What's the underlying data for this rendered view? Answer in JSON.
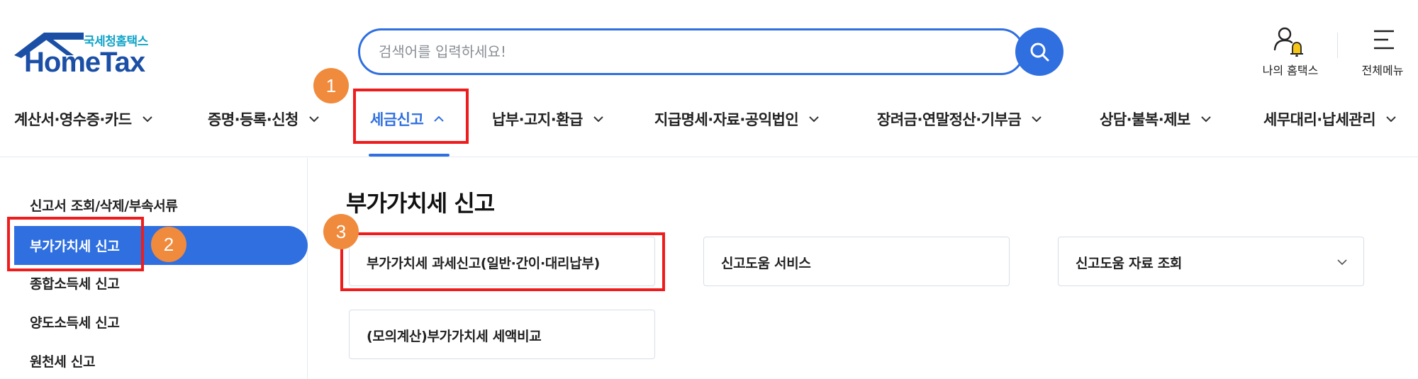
{
  "logo": {
    "sub_text": "국세청홈택스",
    "main_text": "HomeTax"
  },
  "search": {
    "placeholder": "검색어를 입력하세요!"
  },
  "header_actions": {
    "my_hometax": "나의 홈택스",
    "all_menu": "전체메뉴"
  },
  "colors": {
    "accent": "#2f6fe0",
    "annotation_box": "#ee1c1c",
    "annotation_badge": "#f08a3c",
    "logo_text": "#1b4fa6",
    "logo_sub": "#0fa4c8"
  },
  "gnb": {
    "items": [
      {
        "label": "계산서·영수증·카드",
        "expanded": false
      },
      {
        "label": "증명·등록·신청",
        "expanded": false
      },
      {
        "label": "세금신고",
        "expanded": true
      },
      {
        "label": "납부·고지·환급",
        "expanded": false
      },
      {
        "label": "지급명세·자료·공익법인",
        "expanded": false
      },
      {
        "label": "장려금·연말정산·기부금",
        "expanded": false
      },
      {
        "label": "상담·불복·제보",
        "expanded": false
      },
      {
        "label": "세무대리·납세관리",
        "expanded": false
      }
    ]
  },
  "sidebar": {
    "items": [
      {
        "label": "신고서 조회/삭제/부속서류"
      },
      {
        "label": "부가가치세 신고",
        "selected": true
      },
      {
        "label": "종합소득세 신고"
      },
      {
        "label": "양도소득세 신고"
      },
      {
        "label": "원천세 신고"
      }
    ]
  },
  "main": {
    "title": "부가가치세 신고",
    "cards": [
      {
        "label": "부가가치세 과세신고(일반·간이·대리납부)"
      },
      {
        "label": "신고도움 서비스"
      },
      {
        "label": "신고도움 자료 조회",
        "has_dropdown": true
      },
      {
        "label": "(모의계산)부가가치세 세액비교"
      }
    ]
  },
  "annotations": {
    "step1": "1",
    "step2": "2",
    "step3": "3"
  }
}
